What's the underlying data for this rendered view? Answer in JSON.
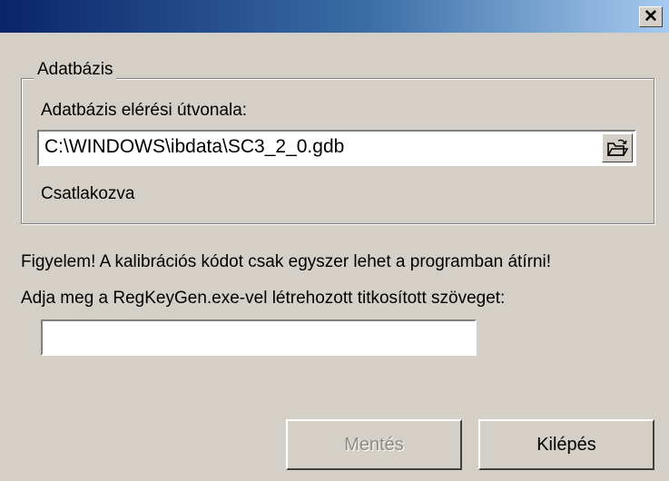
{
  "window": {
    "close_glyph": "✕"
  },
  "database_group": {
    "legend": "Adatbázis",
    "path_label": "Adatbázis elérési útvonala:",
    "path_value": "C:\\WINDOWS\\ibdata\\SC3_2_0.gdb",
    "browse_icon": "open-folder-icon",
    "status": "Csatlakozva"
  },
  "warning_text": "Figyelem! A kalibrációs kódot csak egyszer lehet a programban átírni!",
  "key_prompt": "Adja meg a RegKeyGen.exe-vel létrehozott titkosított szöveget:",
  "key_value": "",
  "buttons": {
    "save": "Mentés",
    "exit": "Kilépés"
  }
}
